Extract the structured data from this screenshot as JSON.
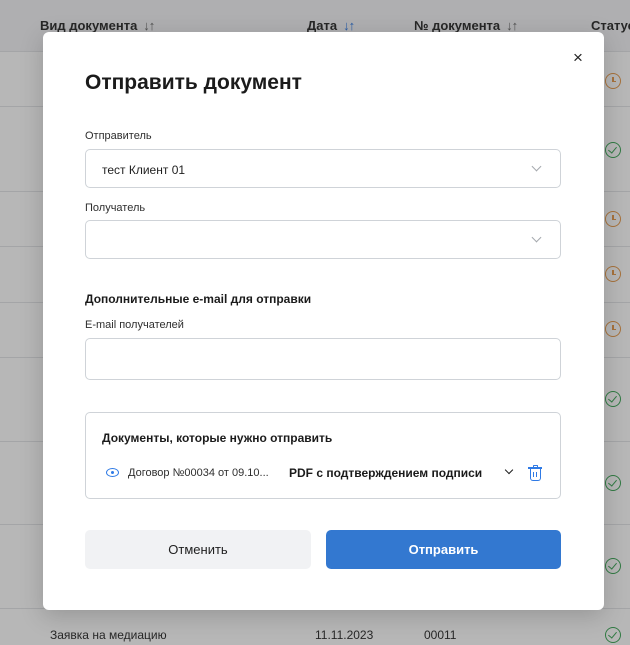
{
  "table": {
    "columns": [
      {
        "label": "Вид документа",
        "sort": "↓↑"
      },
      {
        "label": "Дата",
        "sort": "↓↑"
      },
      {
        "label": "№ документа",
        "sort": "↓↑"
      },
      {
        "label": "Статус"
      }
    ],
    "statuses": [
      "pending",
      "done",
      "pending",
      "pending",
      "pending",
      "done",
      "done",
      "done",
      "done"
    ],
    "last_row": {
      "doc_type": "Заявка на медиацию",
      "date": "11.11.2023",
      "number": "00011"
    }
  },
  "modal": {
    "title": "Отправить документ",
    "close_icon": "×",
    "sender": {
      "label": "Отправитель",
      "value": "тест Клиент 01"
    },
    "recipient": {
      "label": "Получатель",
      "value": ""
    },
    "extra_email": {
      "section_title": "Дополнительные e-mail для отправки",
      "label": "E-mail получателей",
      "value": ""
    },
    "documents": {
      "title": "Документы, которые нужно отправить",
      "items": [
        {
          "name": "Договор №00034 от 09.10...",
          "format": "PDF с подтверждением подписи"
        }
      ]
    },
    "cancel_label": "Отменить",
    "send_label": "Отправить"
  },
  "colors": {
    "accent": "#3378d0",
    "pending": "#e79a4a",
    "done": "#3aa655"
  }
}
